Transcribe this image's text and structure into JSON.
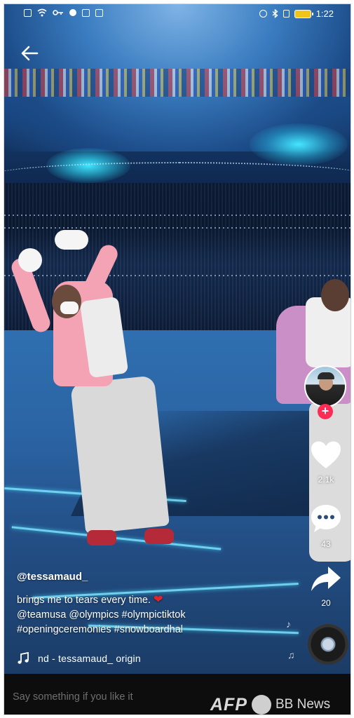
{
  "status_bar": {
    "time": "1:22",
    "battery_color": "#f0c419"
  },
  "video": {
    "back_icon": "back-arrow-icon"
  },
  "actions": {
    "likes": "2.1k",
    "comments": "43",
    "shares": "20",
    "follow_symbol": "+",
    "follow_color": "#fe2c55"
  },
  "caption": {
    "username": "@tessamaud_",
    "line1": "brings me to tears every time.",
    "heart": "❤",
    "line2": "@teamusa @olympics #olympictiktok",
    "line3": "#openingceremonies #snowboardhal"
  },
  "music": {
    "icon": "music-note-icon",
    "text": "nd - tessamaud_     origin"
  },
  "comment_bar": {
    "placeholder": "Say something if you like it"
  },
  "watermark": {
    "afp": "AFP",
    "bb": "BB News"
  }
}
